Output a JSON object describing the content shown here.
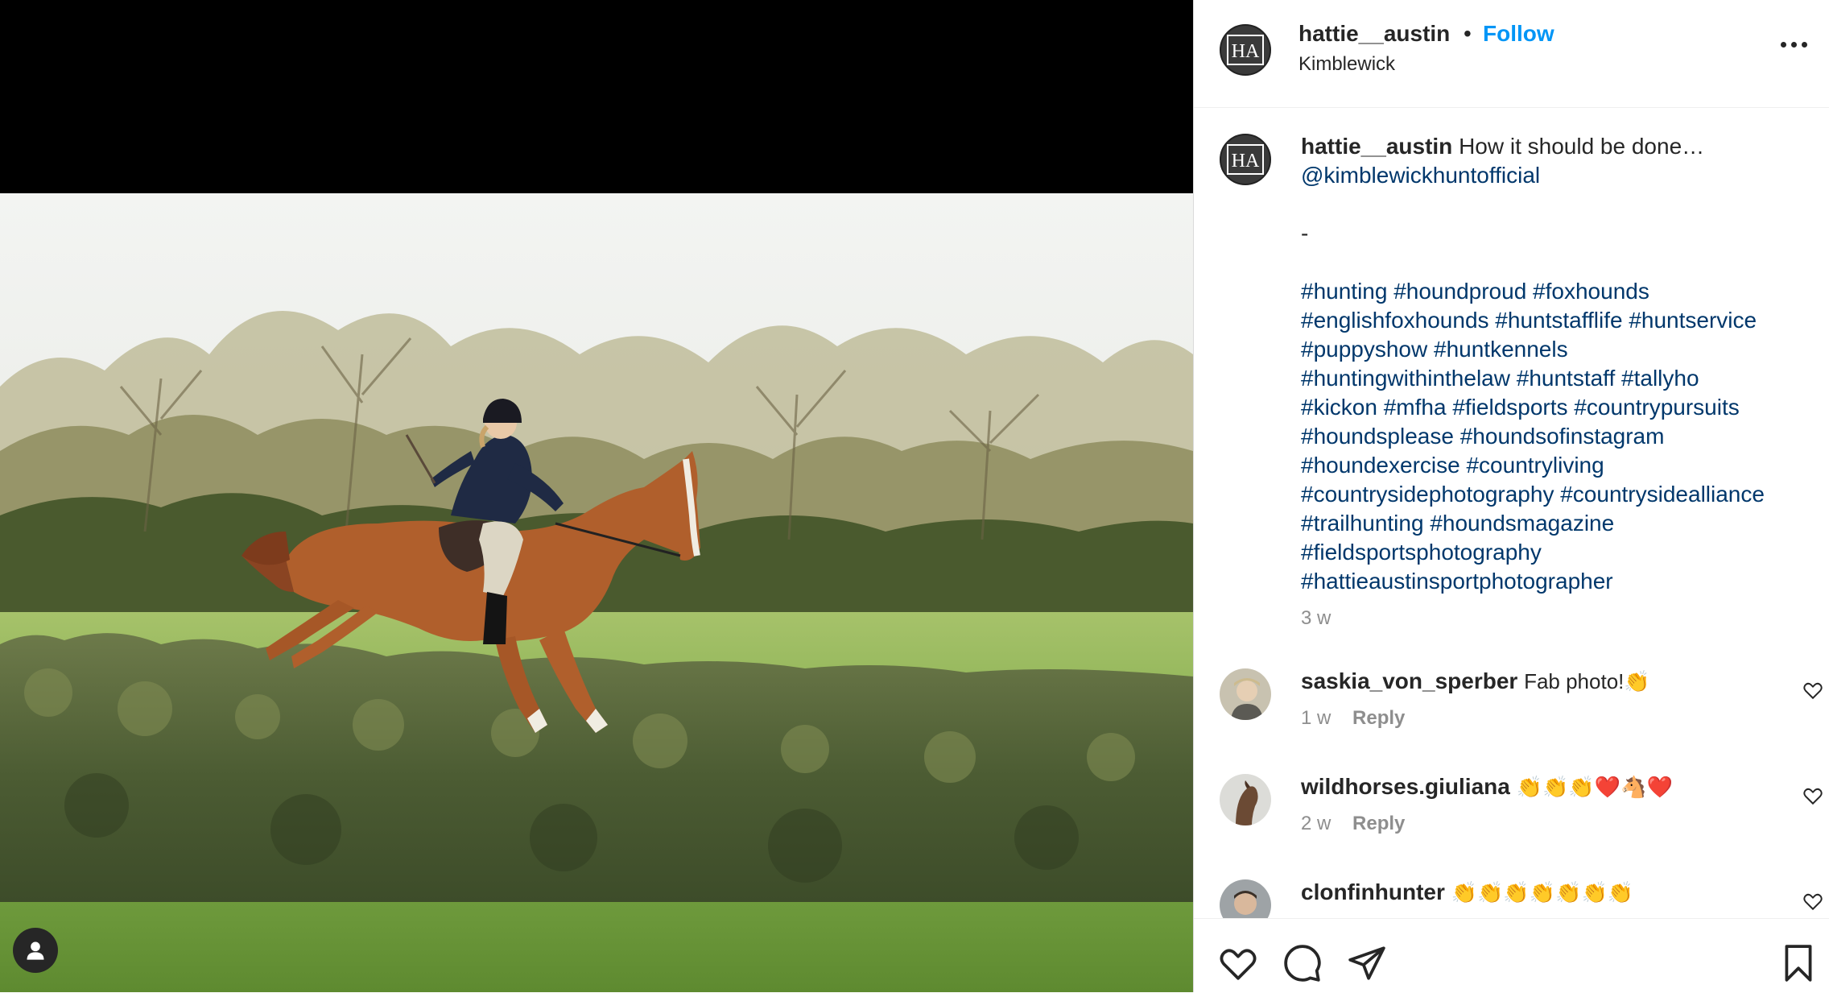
{
  "header": {
    "username": "hattie__austin",
    "separator": "•",
    "follow_label": "Follow",
    "location": "Kimblewick",
    "avatar_text": "HA"
  },
  "caption": {
    "username": "hattie__austin",
    "text": "How it should be done…",
    "mention": "@kimblewickhuntofficial",
    "dash": "-",
    "hashtag_lines": [
      [
        "#hunting",
        "#houndproud",
        "#foxhounds"
      ],
      [
        "#englishfoxhounds",
        "#huntstafflife",
        "#huntservice"
      ],
      [
        "#puppyshow",
        "#huntkennels"
      ],
      [
        "#huntingwithinthelaw",
        "#huntstaff",
        "#tallyho"
      ],
      [
        "#kickon",
        "#mfha",
        "#fieldsports",
        "#countrypursuits"
      ],
      [
        "#houndsplease",
        "#houndsofinstagram"
      ],
      [
        "#houndexercise",
        "#countryliving"
      ],
      [
        "#countrysidephotography",
        "#countrysidealliance"
      ],
      [
        "#trailhunting",
        "#houndsmagazine"
      ],
      [
        "#fieldsportsphotography"
      ],
      [
        "#hattieaustinsportphotographer"
      ]
    ],
    "age": "3 w"
  },
  "comments": [
    {
      "username": "saskia_von_sperber",
      "text": "Fab photo!👏",
      "age": "1 w",
      "reply": "Reply"
    },
    {
      "username": "wildhorses.giuliana",
      "text": "👏👏👏❤️🐴❤️",
      "age": "2 w",
      "reply": "Reply"
    },
    {
      "username": "clonfinhunter",
      "text": "👏👏👏👏👏👏👏",
      "age": "",
      "reply": ""
    }
  ],
  "icons": {
    "user_tag": "person-icon",
    "like": "heart-icon",
    "comment": "comment-icon",
    "share": "paper-plane-icon",
    "save": "bookmark-icon",
    "more": "more-dots-icon"
  },
  "colors": {
    "follow": "#0095f6",
    "link": "#00376b",
    "muted": "#8e8e8e",
    "text": "#262626"
  }
}
